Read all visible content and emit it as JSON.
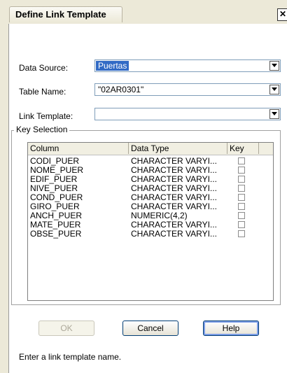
{
  "window": {
    "title": "Define Link Template",
    "close_glyph": "✕"
  },
  "form": {
    "data_source": {
      "label": "Data Source:",
      "value": "Puertas"
    },
    "table_name": {
      "label": "Table Name:",
      "value": "\"02AR0301\""
    },
    "link_template": {
      "label": "Link Template:",
      "value": ""
    }
  },
  "key_selection": {
    "title": "Key Selection",
    "columns": [
      "Column",
      "Data Type",
      "Key"
    ],
    "rows": [
      {
        "column": "CODI_PUER",
        "data_type": "CHARACTER VARYI...",
        "key": false
      },
      {
        "column": "NOME_PUER",
        "data_type": "CHARACTER VARYI...",
        "key": false
      },
      {
        "column": "EDIF_PUER",
        "data_type": "CHARACTER VARYI...",
        "key": false
      },
      {
        "column": "NIVE_PUER",
        "data_type": "CHARACTER VARYI...",
        "key": false
      },
      {
        "column": "COND_PUER",
        "data_type": "CHARACTER VARYI...",
        "key": false
      },
      {
        "column": "GIRO_PUER",
        "data_type": "CHARACTER VARYI...",
        "key": false
      },
      {
        "column": "ANCH_PUER",
        "data_type": "NUMERIC(4,2)",
        "key": false
      },
      {
        "column": "MATE_PUER",
        "data_type": "CHARACTER VARYI...",
        "key": false
      },
      {
        "column": "OBSE_PUER",
        "data_type": "CHARACTER VARYI...",
        "key": false
      }
    ]
  },
  "buttons": {
    "ok": "OK",
    "cancel": "Cancel",
    "help": "Help"
  },
  "status": "Enter a link template name.",
  "colors": {
    "selection": "#316ac5",
    "dialog_bg": "#ece9d8",
    "field_border": "#7f9db9"
  }
}
